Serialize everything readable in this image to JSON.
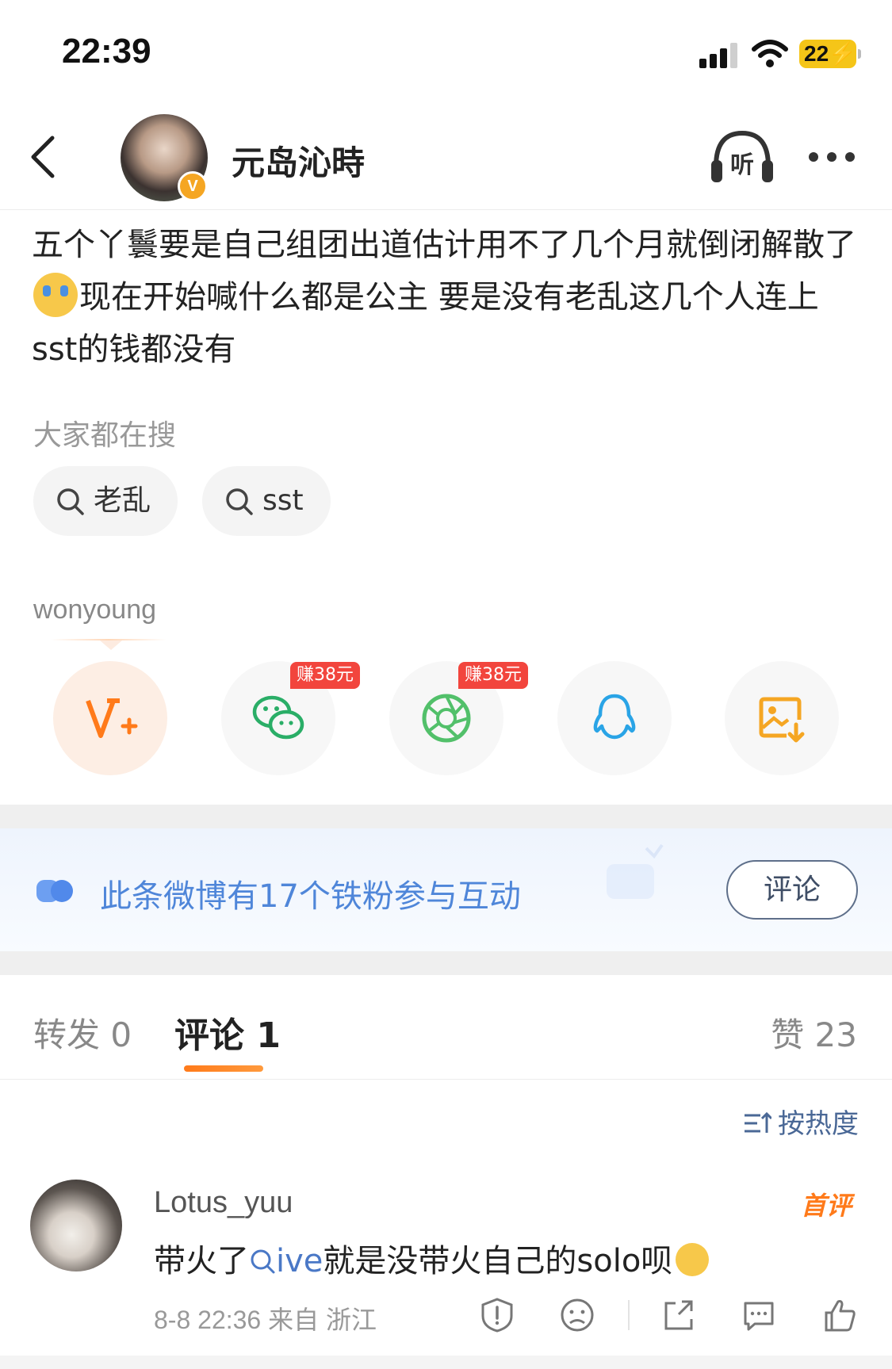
{
  "status_bar": {
    "time": "22:39",
    "battery": "22"
  },
  "header": {
    "username": "元岛沁時",
    "verified_mark": "V"
  },
  "post": {
    "text_before_emoji": "五个丫鬟要是自己组团出道估计用不了几个月就倒闭解散了",
    "text_after_emoji": "现在开始喊什么都是公主 要是没有老乱这几个人连上sst的钱都没有"
  },
  "search": {
    "title": "大家都在搜",
    "chips": [
      {
        "label": "老乱"
      },
      {
        "label": "sst"
      }
    ]
  },
  "share": {
    "label": "wonyoung",
    "buttons": [
      {
        "icon": "v-plus-icon"
      },
      {
        "icon": "wechat-icon",
        "badge": "赚38元"
      },
      {
        "icon": "moments-icon",
        "badge": "赚38元"
      },
      {
        "icon": "qq-icon"
      },
      {
        "icon": "save-image-icon"
      }
    ]
  },
  "fans_banner": {
    "text": "此条微博有17个铁粉参与互动",
    "button": "评论"
  },
  "tabs": {
    "forward": "转发 0",
    "comment": "评论 1",
    "likes": "赞 23"
  },
  "sort": {
    "label": "按热度"
  },
  "comment": {
    "user": "Lotus_yuu",
    "tag": "首评",
    "text_before": "带火了",
    "link": "ive",
    "text_after": "就是没带火自己的solo呗",
    "meta": "8-8 22:36  来自 浙江"
  },
  "colors": {
    "accent": "#ff7a1a",
    "link": "#4a78c6",
    "badge": "#f2453d"
  }
}
